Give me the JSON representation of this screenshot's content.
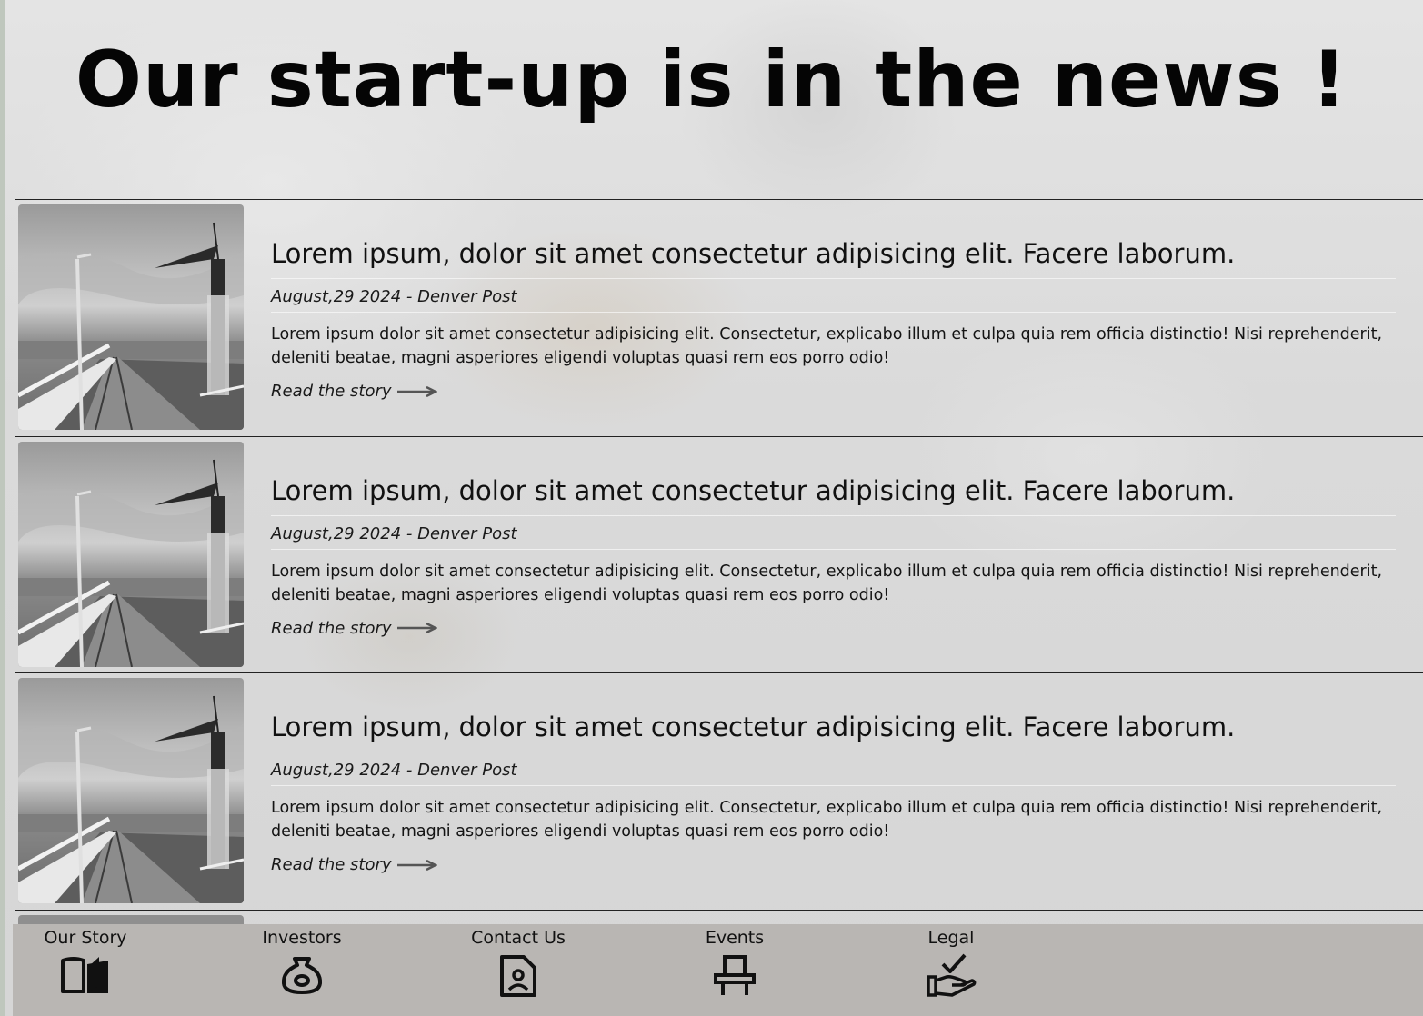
{
  "page": {
    "title": "Our start-up is in the news !"
  },
  "articles": [
    {
      "headline": "Lorem ipsum, dolor sit amet consectetur adipisicing elit. Facere laborum.",
      "date_source": "August,29 2024 - Denver Post",
      "summary": "Lorem ipsum dolor sit amet consectetur adipisicing elit. Consectetur, explicabo illum et culpa quia rem officia distinctio! Nisi reprehenderit, deleniti beatae, magni asperiores eligendi voluptas quasi rem eos porro odio!",
      "link_label": "Read the story",
      "image": "pier-photo"
    },
    {
      "headline": "Lorem ipsum, dolor sit amet consectetur adipisicing elit. Facere laborum.",
      "date_source": "August,29 2024 - Denver Post",
      "summary": "Lorem ipsum dolor sit amet consectetur adipisicing elit. Consectetur, explicabo illum et culpa quia rem officia distinctio! Nisi reprehenderit, deleniti beatae, magni asperiores eligendi voluptas quasi rem eos porro odio!",
      "link_label": "Read the story",
      "image": "pier-photo"
    },
    {
      "headline": "Lorem ipsum, dolor sit amet consectetur adipisicing elit. Facere laborum.",
      "date_source": "August,29 2024 - Denver Post",
      "summary": "Lorem ipsum dolor sit amet consectetur adipisicing elit. Consectetur, explicabo illum et culpa quia rem officia distinctio! Nisi reprehenderit, deleniti beatae, magni asperiores eligendi voluptas quasi rem eos porro odio!",
      "link_label": "Read the story",
      "image": "pier-photo"
    }
  ],
  "bottom_nav": {
    "items": [
      {
        "label": "Our Story",
        "icon": "open-book-icon"
      },
      {
        "label": "Investors",
        "icon": "money-bag-icon"
      },
      {
        "label": "Contact Us",
        "icon": "contact-document-icon"
      },
      {
        "label": "Events",
        "icon": "chair-icon"
      },
      {
        "label": "Legal",
        "icon": "hand-check-icon"
      }
    ]
  },
  "colors": {
    "nav_background": "#b9b6b3",
    "divider": "#222222",
    "text": "#111111"
  }
}
